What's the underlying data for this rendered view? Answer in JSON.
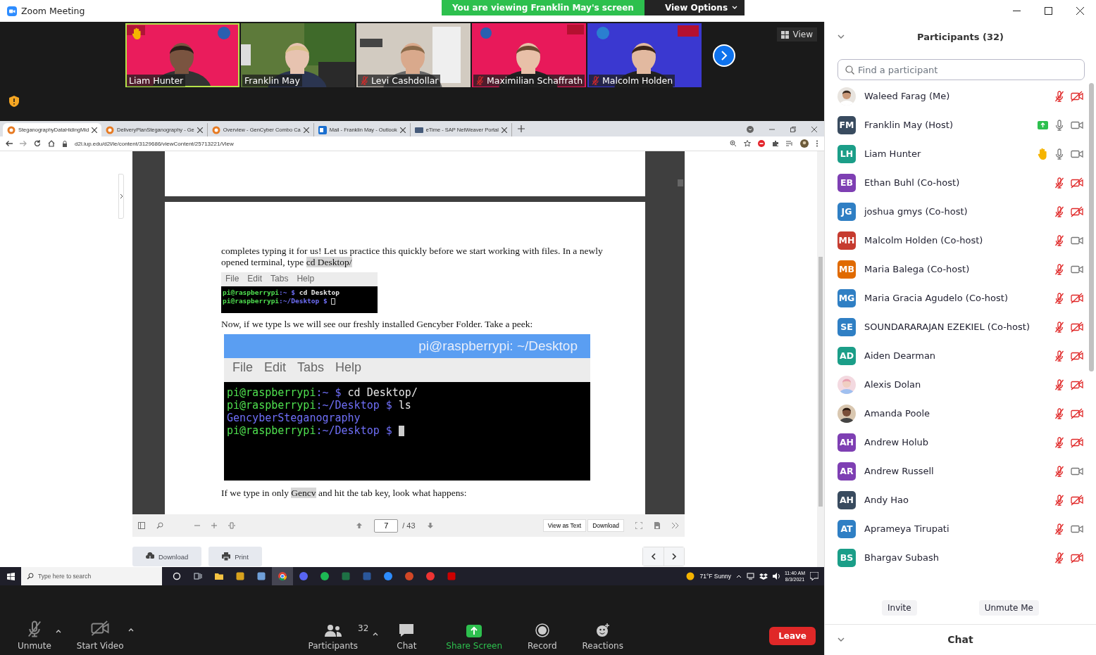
{
  "window": {
    "title": "Zoom Meeting"
  },
  "share_banner": {
    "text": "You are viewing Franklin May's screen",
    "view_options": "View Options"
  },
  "video_strip": {
    "view_label": "View",
    "tiles": [
      {
        "name": "Liam Hunter",
        "muted": false,
        "hand_raised": true,
        "selected": true
      },
      {
        "name": "Franklin May",
        "muted": false,
        "hand_raised": false,
        "selected": false
      },
      {
        "name": "Levi Cashdollar",
        "muted": true,
        "hand_raised": false,
        "selected": false
      },
      {
        "name": "Maximilian Schaffrath",
        "muted": true,
        "hand_raised": false,
        "selected": false
      },
      {
        "name": "Malcolm Holden",
        "muted": true,
        "hand_raised": false,
        "selected": false
      }
    ]
  },
  "shared_screen": {
    "browser": {
      "tabs": [
        {
          "label": "SteganographyDataHidingMid",
          "selected": true,
          "kind": "d2l"
        },
        {
          "label": "DeliveryPlanSteganography - Ge",
          "selected": false,
          "kind": "d2l"
        },
        {
          "label": "Overview - GenCyber Combo Ca",
          "selected": false,
          "kind": "d2l"
        },
        {
          "label": "Mail - Franklin May - Outlook",
          "selected": false,
          "kind": "mail"
        },
        {
          "label": "eTime - SAP NetWeaver Portal",
          "selected": false,
          "kind": "portal"
        }
      ],
      "url": "d2l.iup.edu/d2l/le/content/3129686/viewContent/25713221/View"
    },
    "document": {
      "paragraph_1": [
        {
          "text": "completes typing it for us! Let us practice this quickly before we start working with files.  In a newly opened terminal, type ",
          "highlighted": false
        },
        {
          "text": "cd Desktop/",
          "highlighted": true
        }
      ],
      "terminal_1": {
        "menu": [
          "File",
          "Edit",
          "Tabs",
          "Help"
        ],
        "lines": [
          [
            {
              "text": "pi@raspberrypi",
              "kind": "user"
            },
            {
              "text": ":~ $ ",
              "kind": "path"
            },
            {
              "text": "cd Desktop",
              "kind": "cmd"
            }
          ],
          [
            {
              "text": "pi@raspberrypi",
              "kind": "user"
            },
            {
              "text": ":~/Desktop $ ",
              "kind": "path"
            }
          ]
        ]
      },
      "paragraph_2": [
        {
          "text": "Now, if we type ls we will see our freshly installed Gencyber Folder. Take a peek:",
          "highlighted": false
        }
      ],
      "terminal_2": {
        "title": "pi@raspberrypi: ~/Desktop",
        "menu": [
          "File",
          "Edit",
          "Tabs",
          "Help"
        ],
        "lines": [
          [
            {
              "text": "pi@raspberrypi",
              "kind": "user"
            },
            {
              "text": ":~ $ ",
              "kind": "path"
            },
            {
              "text": "cd Desktop/",
              "kind": "cmd"
            }
          ],
          [
            {
              "text": "pi@raspberrypi",
              "kind": "user"
            },
            {
              "text": ":~/Desktop $ ",
              "kind": "path"
            },
            {
              "text": "ls",
              "kind": "cmd"
            }
          ],
          [
            {
              "text": "GencyberSteganography",
              "kind": "dir"
            }
          ],
          [
            {
              "text": "pi@raspberrypi",
              "kind": "user"
            },
            {
              "text": ":~/Desktop $ ",
              "kind": "path"
            }
          ]
        ]
      },
      "paragraph_3": [
        {
          "text": "If we type in only ",
          "highlighted": false
        },
        {
          "text": "Gencv",
          "highlighted": true
        },
        {
          "text": " and hit the tab key, look what happens:",
          "highlighted": false
        }
      ]
    },
    "pdf_toolbar": {
      "page": "7",
      "total": "/ 43",
      "view_as_text": "View as Text",
      "download": "Download"
    },
    "download_button": "Download",
    "print_button": "Print"
  },
  "taskbar": {
    "search_placeholder": "Type here to search",
    "weather": "71°F  Sunny",
    "time": "11:40 AM",
    "date": "8/3/2021"
  },
  "toolbar": {
    "unmute": "Unmute",
    "start_video": "Start Video",
    "participants": "Participants",
    "participant_count": "32",
    "chat": "Chat",
    "share_screen": "Share Screen",
    "record": "Record",
    "reactions": "Reactions",
    "leave": "Leave"
  },
  "participants_panel": {
    "title": "Participants (32)",
    "search": {
      "placeholder": "Find a participant"
    },
    "participants": [
      {
        "name": "Waleed Farag (Me)",
        "muted": true,
        "video_off": true,
        "sharing": false,
        "hand_raised": false
      },
      {
        "name": "Franklin May (Host)",
        "kind": "initials",
        "initials": "FM",
        "color": "#394b5f",
        "muted": false,
        "video_off": false,
        "sharing": true,
        "hand_raised": false
      },
      {
        "name": "Liam Hunter",
        "kind": "initials",
        "initials": "LH",
        "color": "#1b9e88",
        "muted": false,
        "video_off": false,
        "sharing": false,
        "hand_raised": true
      },
      {
        "name": "Ethan Buhl (Co-host)",
        "kind": "initials",
        "initials": "EB",
        "color": "#7e3fb3",
        "muted": true,
        "video_off": true,
        "sharing": false,
        "hand_raised": false
      },
      {
        "name": "joshua gmys (Co-host)",
        "kind": "initials",
        "initials": "JG",
        "color": "#2f7fc4",
        "muted": true,
        "video_off": true,
        "sharing": false,
        "hand_raised": false
      },
      {
        "name": "Malcolm Holden (Co-host)",
        "kind": "initials",
        "initials": "MH",
        "color": "#c63b2f",
        "muted": true,
        "video_off": false,
        "sharing": false,
        "hand_raised": false
      },
      {
        "name": "Maria Balega (Co-host)",
        "kind": "initials",
        "initials": "MB",
        "color": "#e06a00",
        "muted": true,
        "video_off": false,
        "sharing": false,
        "hand_raised": false
      },
      {
        "name": "Maria Gracia Agudelo (Co-host)",
        "kind": "initials",
        "initials": "MG",
        "color": "#2f7fc4",
        "muted": true,
        "video_off": true,
        "sharing": false,
        "hand_raised": false
      },
      {
        "name": "SOUNDARARAJAN EZEKIEL (Co-host)",
        "kind": "initials",
        "initials": "SE",
        "color": "#2f7fc4",
        "muted": true,
        "video_off": true,
        "sharing": false,
        "hand_raised": false
      },
      {
        "name": "Aiden Dearman",
        "kind": "initials",
        "initials": "AD",
        "color": "#1b9e88",
        "muted": true,
        "video_off": true,
        "sharing": false,
        "hand_raised": false
      },
      {
        "name": "Alexis Dolan",
        "muted": true,
        "video_off": true,
        "sharing": false,
        "hand_raised": false
      },
      {
        "name": "Amanda Poole",
        "muted": true,
        "video_off": true,
        "sharing": false,
        "hand_raised": false
      },
      {
        "name": "Andrew Holub",
        "kind": "initials",
        "initials": "AH",
        "color": "#7e3fb3",
        "muted": true,
        "video_off": true,
        "sharing": false,
        "hand_raised": false
      },
      {
        "name": "Andrew Russell",
        "kind": "initials",
        "initials": "AR",
        "color": "#7e3fb3",
        "muted": true,
        "video_off": false,
        "sharing": false,
        "hand_raised": false
      },
      {
        "name": "Andy Hao",
        "kind": "initials",
        "initials": "AH",
        "color": "#394b5f",
        "muted": true,
        "video_off": true,
        "sharing": false,
        "hand_raised": false
      },
      {
        "name": "Aprameya Tirupati",
        "kind": "initials",
        "initials": "AT",
        "color": "#2f7fc4",
        "muted": true,
        "video_off": false,
        "sharing": false,
        "hand_raised": false
      },
      {
        "name": "Bhargav Subash",
        "kind": "initials",
        "initials": "BS",
        "color": "#1b9e88",
        "muted": true,
        "video_off": true,
        "sharing": false,
        "hand_raised": false
      }
    ],
    "invite": "Invite",
    "unmute_me": "Unmute Me",
    "chat": "Chat"
  }
}
